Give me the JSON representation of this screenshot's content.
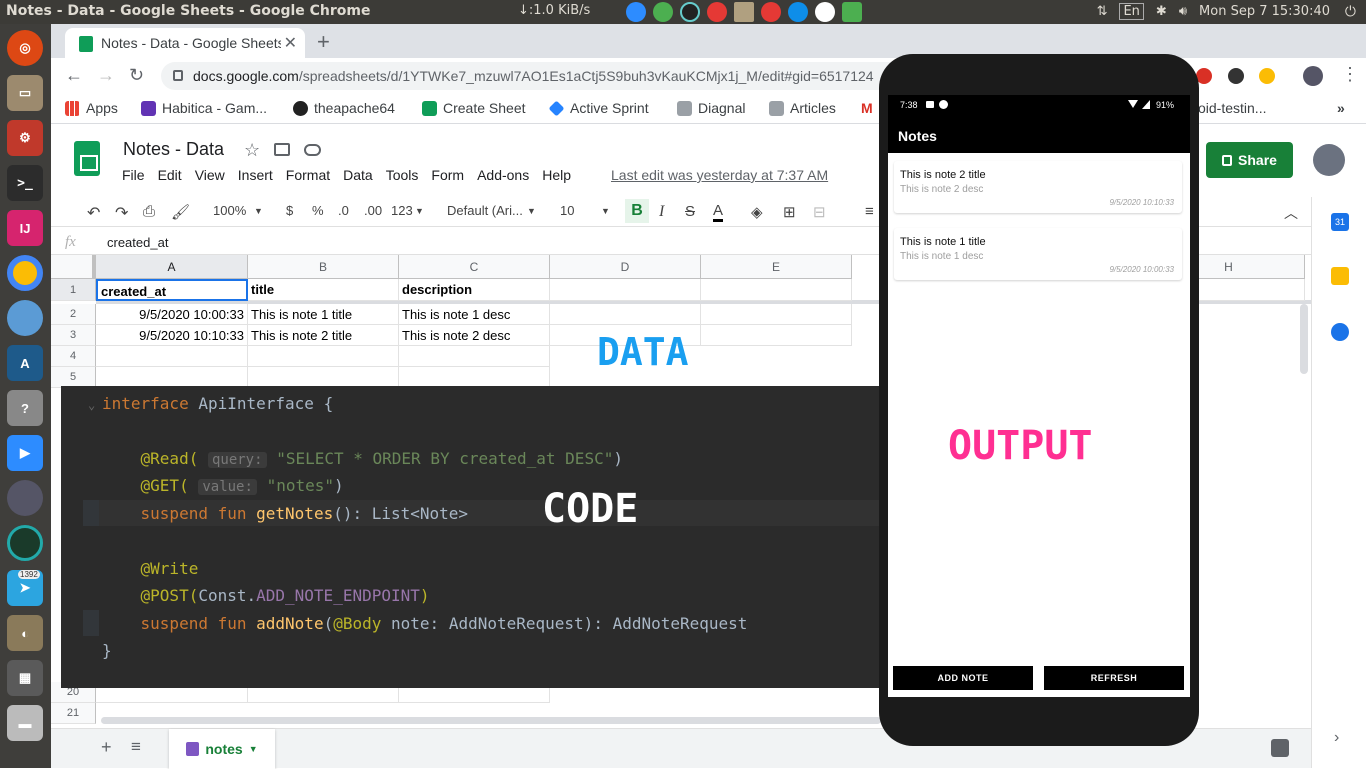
{
  "topbar": {
    "window_title": "Notes - Data - Google Sheets - Google Chrome",
    "net_speed": "↓:1.0 KiB/s",
    "keyboard": "En",
    "clock": "Mon Sep  7 15:30:40"
  },
  "launcher": {
    "telegram_badge": "1392"
  },
  "chrome": {
    "tab_title": "Notes - Data - Google Sheets",
    "url_host": "docs.google.com",
    "url_path": "/spreadsheets/d/1YTWKe7_mzuwl7AO1Es1aCtj5S9buh3vKauKCMjx1j_M/edit#gid=6517124",
    "bookmarks": [
      "Apps",
      "Habitica - Gam...",
      "theapache64",
      "Create Sheet",
      "Active Sprint",
      "Diagnal",
      "Articles",
      "M",
      "oid-testin..."
    ]
  },
  "sheets": {
    "doc_title": "Notes - Data",
    "menu": [
      "File",
      "Edit",
      "View",
      "Insert",
      "Format",
      "Data",
      "Tools",
      "Form",
      "Add-ons",
      "Help"
    ],
    "last_edit": "Last edit was yesterday at 7:37 AM",
    "share_label": "Share",
    "toolbar": {
      "zoom": "100%",
      "currency": "$",
      "percent": "%",
      "dec_less": ".0",
      "dec_more": ".00",
      "format_more": "123",
      "font": "Default (Ari...",
      "font_size": "10"
    },
    "formula_label": "fx",
    "formula_value": "created_at",
    "columns": [
      "A",
      "B",
      "C",
      "D",
      "E",
      "H"
    ],
    "rows": [
      "1",
      "2",
      "3",
      "4",
      "5",
      "20",
      "21"
    ],
    "header_row": [
      "created_at",
      "title",
      "description"
    ],
    "data_rows": [
      [
        "9/5/2020 10:00:33",
        "This is note 1 title",
        "This is note 1 desc"
      ],
      [
        "9/5/2020 10:10:33",
        "This is note 2 title",
        "This is note 2 desc"
      ]
    ],
    "sheet_tab": "notes",
    "side_calendar": "31"
  },
  "overlays": {
    "data_label": "DATA",
    "code_label": "CODE",
    "output_label": "OUTPUT"
  },
  "code": {
    "l1_kw": "interface",
    "l1_rest": " ApiInterface {",
    "l2_an": "@Read(",
    "l2_hint": "query:",
    "l2_str": "\"SELECT * ORDER BY created_at DESC\"",
    "l2_close": ")",
    "l3_an": "@GET(",
    "l3_hint": "value:",
    "l3_str": "\"notes\"",
    "l3_close": ")",
    "l4_kw": "suspend fun",
    "l4_fn": "getNotes",
    "l4_rest": "(): List<Note>",
    "l5_an": "@Write",
    "l6_an": "@POST(",
    "l6_cls": "Const.",
    "l6_const": "ADD_NOTE_ENDPOINT",
    "l6_close": ")",
    "l7_kw": "suspend fun",
    "l7_fn": "addNote",
    "l7_open": "(",
    "l7_an": "@Body",
    "l7_rest": " note: AddNoteRequest): AddNoteRequest",
    "l8": "}"
  },
  "phone": {
    "time": "7:38",
    "battery": "91%",
    "app_title": "Notes",
    "notes": [
      {
        "title": "This is note 2 title",
        "desc": "This is note 2 desc",
        "timestamp": "9/5/2020 10:10:33"
      },
      {
        "title": "This is note 1 title",
        "desc": "This is note 1 desc",
        "timestamp": "9/5/2020 10:00:33"
      }
    ],
    "add_button": "ADD NOTE",
    "refresh_button": "REFRESH"
  }
}
